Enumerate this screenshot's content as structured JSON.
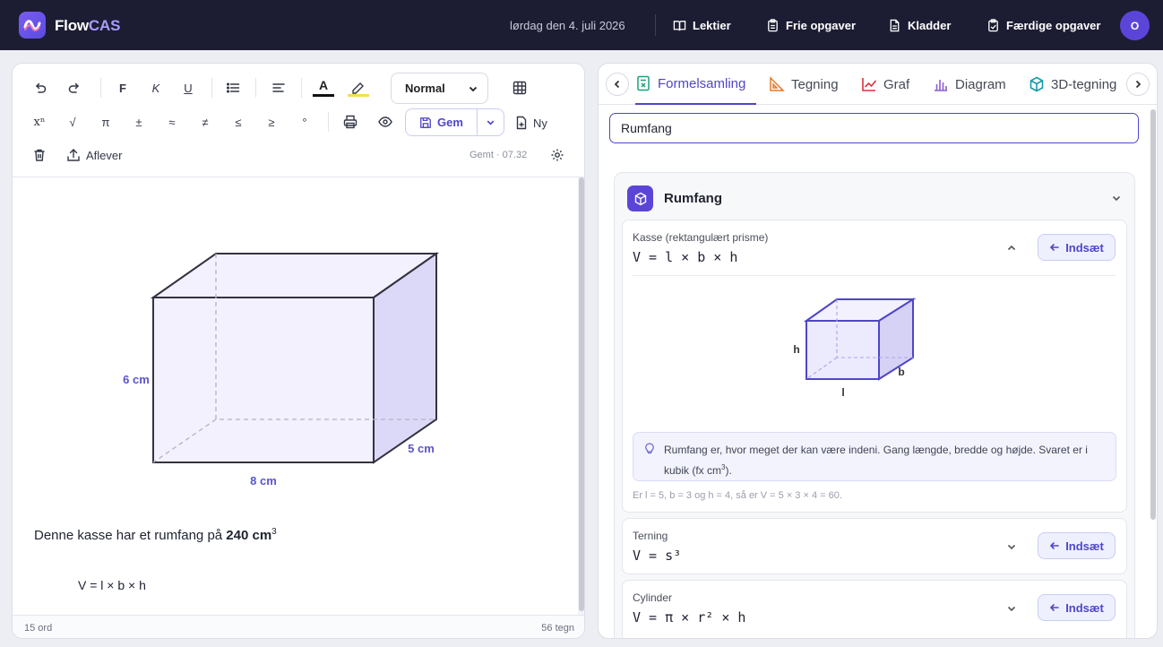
{
  "app": {
    "name_part1": "Flow",
    "name_part2": "CAS"
  },
  "topbar": {
    "date": "lørdag den 4. juli 2026",
    "nav": [
      "Lektier",
      "Frie opgaver",
      "Kladder",
      "Færdige opgaver"
    ],
    "avatar": "O"
  },
  "editor": {
    "toolbar": {
      "bold": "F",
      "italic": "K",
      "underline": "U",
      "style_select": "Normal",
      "symbols": [
        "xⁿ",
        "√",
        "π",
        "±",
        "≈",
        "≠",
        "≤",
        "≥",
        "°"
      ],
      "save_label": "Gem",
      "new_label": "Ny",
      "submit_label": "Aflever",
      "saved_status": "Gemt · 07.32"
    },
    "figure": {
      "height": "6 cm",
      "length": "8 cm",
      "depth": "5 cm"
    },
    "text_prefix": "Denne kasse har et rumfang på ",
    "text_value": "240 cm",
    "text_sup": "3",
    "formula": "V = l × b × h",
    "status": {
      "words": "15 ord",
      "chars": "56 tegn"
    }
  },
  "panel": {
    "tabs": [
      "Formelsamling",
      "Tegning",
      "Graf",
      "Diagram",
      "3D-tegning"
    ],
    "active_tab": "Formelsamling",
    "search_value": "Rumfang",
    "group_title": "Rumfang",
    "insert_label": "Indsæt",
    "cards": [
      {
        "name": "Kasse (rektangulært prisme)",
        "formula": "V = l × b × h",
        "expanded": true
      },
      {
        "name": "Terning",
        "formula": "V = s³",
        "expanded": false
      },
      {
        "name": "Cylinder",
        "formula": "V = π × r² × h",
        "expanded": false
      }
    ],
    "diagram_labels": {
      "h": "h",
      "l": "l",
      "b": "b"
    },
    "tip_text_a": "Rumfang er, hvor meget der kan være indeni. Gang længde, bredde og højde. Svaret er i kubik (fx cm",
    "tip_sup": "3",
    "tip_text_b": ").",
    "example": "Er l = 5, b = 3 og h = 4, så er V = 5 × 3 × 4 = 60."
  },
  "colors": {
    "accent": "#4f46c8",
    "topbar": "#1c1d33",
    "box_fill": "#f2f1fd",
    "box_side": "#dcd9f8"
  }
}
